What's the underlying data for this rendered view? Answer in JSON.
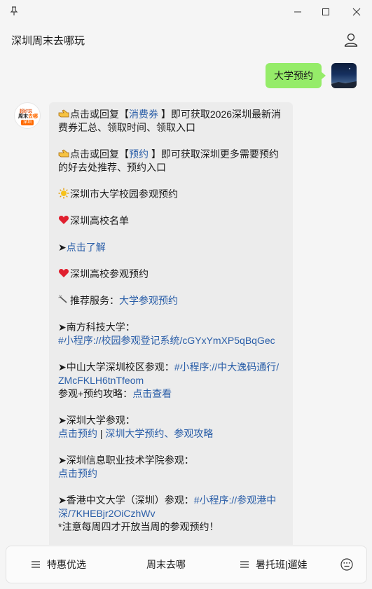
{
  "window": {
    "controls": [
      "pin",
      "minimize",
      "maximize",
      "close"
    ]
  },
  "header": {
    "title": "深圳周末去哪玩"
  },
  "outgoing": {
    "text": "大学预约"
  },
  "bot_avatar": {
    "top": "超好玩",
    "mid_a": "周末",
    "mid_b": "去哪",
    "tag": "深圳"
  },
  "message": {
    "l1a": "点击或回复【",
    "l1link": "消费券",
    "l1b": " 】即可获取2026深圳最新消",
    "l2": "费券汇总、领取时间、领取入口",
    "l3a": "点击或回复【",
    "l3link": "预约",
    "l3b": " 】即可获取深圳更多需要预约",
    "l4": "的好去处推荐、预约入口",
    "l5": "深圳市大学校园参观预约",
    "l6": "深圳高校名单",
    "l7a": "➤",
    "l7link": "点击了解",
    "l8": "深圳高校参观预约",
    "l9a": "推荐服务：",
    "l9link": "大学参观预约",
    "l10": "➤南方科技大学：",
    "l11link": "#小程序://校园参观登记系统/cGYxYmXP5qBqGec",
    "l12a": "➤中山大学深圳校区参观：",
    "l12link": "#小程序://中大逸码通行/",
    "l13link": "ZMcFKLH6tnTfeom",
    "l14a": "参观+预约攻略：",
    "l14link": "点击查看",
    "l15": "➤深圳大学参观：",
    "l16link1": "点击预约",
    "l16sep": " | ",
    "l16link2": "深圳大学预约、参观攻略",
    "l17": "➤深圳信息职业技术学院参观：",
    "l18link": "点击预约",
    "l19a": "➤香港中文大学（深圳）参观：",
    "l19link": "#小程序://参观港中",
    "l20link": "深/7KHEBjr2OiCzhWv",
    "l21": "*注意每周四才开放当周的参观预约！"
  },
  "bottom_menu": {
    "item1": "特惠优选",
    "item2": "周末去哪",
    "item3": "暑托班|遛娃"
  },
  "colors": {
    "outgoing_bubble": "#95ec69",
    "incoming_bubble": "#ececec",
    "link": "#2a5ea8",
    "background": "#f5f5f5"
  },
  "icons": [
    "pin-icon",
    "minimize-icon",
    "maximize-icon",
    "close-icon",
    "user-icon",
    "pointing-hand-icon",
    "sun-icon",
    "heart-icon",
    "sparkle-icon",
    "menu-icon",
    "keyboard-icon"
  ]
}
